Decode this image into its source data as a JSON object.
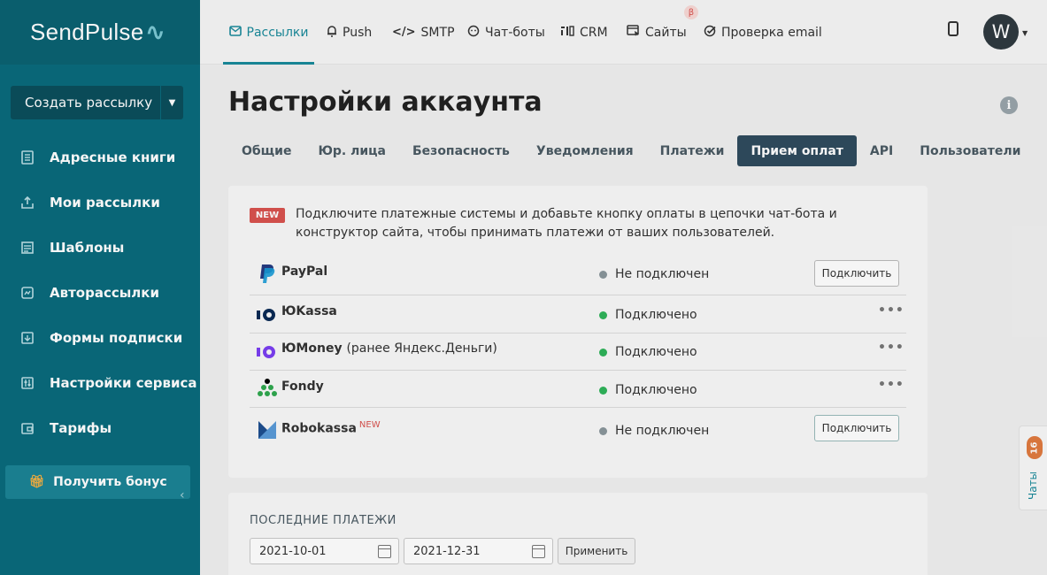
{
  "sidebar": {
    "logo": "SendPulse",
    "logo_mark": "∿",
    "create_button": "Создать рассылку",
    "items": [
      {
        "label": "Адресные книги",
        "icon": "book-icon"
      },
      {
        "label": "Мои рассылки",
        "icon": "upload-icon"
      },
      {
        "label": "Шаблоны",
        "icon": "template-icon"
      },
      {
        "label": "Авторассылки",
        "icon": "automation-icon"
      },
      {
        "label": "Формы подписки",
        "icon": "form-icon"
      },
      {
        "label": "Настройки сервиса",
        "icon": "settings-icon"
      },
      {
        "label": "Тарифы",
        "icon": "wallet-icon"
      }
    ],
    "bonus_button": "Получить бонус"
  },
  "topnav": {
    "items": [
      {
        "label": "Рассылки",
        "icon": "mail-icon",
        "active": true
      },
      {
        "label": "Push",
        "icon": "bell-icon"
      },
      {
        "label": "SMTP",
        "icon": "code-icon"
      },
      {
        "label": "Чат-боты",
        "icon": "chatbot-icon"
      },
      {
        "label": "CRM",
        "icon": "crm-icon"
      },
      {
        "label": "Сайты",
        "icon": "site-icon",
        "badge": "β"
      },
      {
        "label": "Проверка email",
        "icon": "check-icon"
      }
    ],
    "avatar_letter": "W"
  },
  "page": {
    "title": "Настройки аккаунта",
    "tabs": [
      "Общие",
      "Юр. лица",
      "Безопасность",
      "Уведомления",
      "Платежи",
      "Прием оплат",
      "API",
      "Пользователи"
    ],
    "active_tab": "Прием оплат"
  },
  "payments": {
    "new_badge": "NEW",
    "intro": "Подключите платежные системы и добавьте кнопку оплаты в цепочки чат-бота и конструктор сайта, чтобы принимать платежи от ваших пользователей.",
    "connect_label": "Подключить",
    "more_label": "•••",
    "rows": [
      {
        "name": "PayPal",
        "status": "Не подключен",
        "connected": false
      },
      {
        "name": "ЮKassa",
        "status": "Подключено",
        "connected": true
      },
      {
        "name": "ЮMoney",
        "name_suffix": "(ранее Яндекс.Деньги)",
        "status": "Подключено",
        "connected": true
      },
      {
        "name": "Fondy",
        "status": "Подключено",
        "connected": true
      },
      {
        "name": "Robokassa",
        "name_badge": "NEW",
        "status": "Не подключен",
        "connected": false
      }
    ],
    "colors": {
      "connected": "#2fb35a",
      "disconnected": "#8a969c"
    }
  },
  "last_payments": {
    "title": "ПОСЛЕДНИЕ ПЛАТЕЖИ",
    "date_from": "2021-10-01",
    "date_to": "2021-12-31",
    "apply_label": "Применить"
  },
  "chats": {
    "label": "Чаты",
    "count": "16"
  }
}
